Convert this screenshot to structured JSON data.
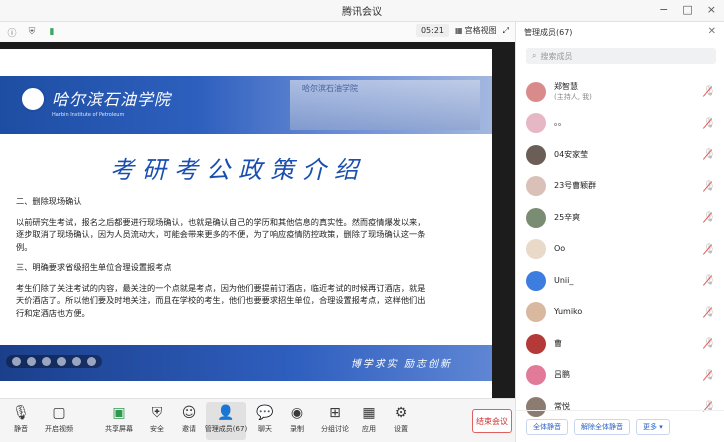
{
  "window": {
    "title": "腾讯会议",
    "controls": [
      "−",
      "□",
      "×"
    ]
  },
  "topbar": {
    "time": "05:21",
    "view_label": "宫格视图",
    "members_label": "管理成员(67)"
  },
  "slide": {
    "school_name": "哈尔滨石油学院",
    "school_name_en": "Harbin Institute of Petroleum",
    "header_sign": "哈尔滨石油学院",
    "title": "考研考公政策介绍",
    "section2_heading": "二、删除现场确认",
    "section2_text": "以前研究生考试，报名之后都要进行现场确认，也就是确认自己的学历和其他信息的真实性。然而疫情爆发以来，逐步取消了现场确认，因为人员流动大，可能会带来更多的不便，为了响应疫情防控政策，删除了现场确认这一条例。",
    "section3_heading": "三、明确要求省级招生单位合理设置报考点",
    "section3_text": "考生们除了关注考试的内容，最关注的一个点就是考点，因为他们要提前订酒店，临近考试的时候再订酒店，就是天价酒店了。所以他们要及时地关注，而且在学校的考生，他们也要要求招生单位，合理设置报考点，这样他们出行和定酒店也方便。",
    "motto": "博学求实  励志创新"
  },
  "toolbar": {
    "mute": "静音",
    "video": "开启视频",
    "share": "共享屏幕",
    "security": "安全",
    "invite": "邀请",
    "members": "管理成员(67)",
    "chat": "聊天",
    "record": "录制",
    "breakout": "分组讨论",
    "apps": "应用",
    "settings": "设置",
    "end": "结束会议"
  },
  "panel": {
    "search_placeholder": "搜索成员",
    "participants": [
      {
        "name": "郑智慧",
        "sub": "(主持人, 我)",
        "avatar_color": "#d98a8a"
      },
      {
        "name": "。。",
        "sub": "",
        "avatar_color": "#e6b7c4"
      },
      {
        "name": "04安家莹",
        "sub": "",
        "avatar_color": "#6b5e57"
      },
      {
        "name": "23号曹颖群",
        "sub": "",
        "avatar_color": "#d9c0b8"
      },
      {
        "name": "25辛爽",
        "sub": "",
        "avatar_color": "#7a8c72"
      },
      {
        "name": "Oo",
        "sub": "",
        "avatar_color": "#e8d9c8"
      },
      {
        "name": "Unii_",
        "sub": "",
        "avatar_color": "#3d7de0"
      },
      {
        "name": "Yumiko",
        "sub": "",
        "avatar_color": "#d9b8a0"
      },
      {
        "name": "曹",
        "sub": "",
        "avatar_color": "#b43a3a"
      },
      {
        "name": "吕鹏",
        "sub": "",
        "avatar_color": "#e27a9a"
      },
      {
        "name": "常悦",
        "sub": "",
        "avatar_color": "#8c7c70"
      }
    ],
    "mute_all": "全体静音",
    "unmute_all": "解除全体静音",
    "more": "更多 ▾"
  }
}
